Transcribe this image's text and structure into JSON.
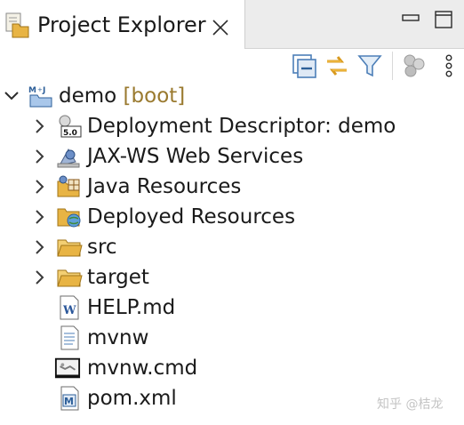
{
  "view": {
    "title": "Project Explorer",
    "icon": "project-explorer-icon",
    "close_icon": "close-icon",
    "minimize_icon": "minimize-icon",
    "maximize_icon": "maximize-icon"
  },
  "toolbar": {
    "buttons": [
      {
        "name": "collapse-all-button",
        "icon": "collapse-all-icon"
      },
      {
        "name": "link-with-editor-button",
        "icon": "link-with-editor-icon"
      },
      {
        "name": "filter-button",
        "icon": "filter-icon"
      },
      {
        "name": "focus-on-active-task-button",
        "icon": "focus-task-icon"
      },
      {
        "name": "view-menu-button",
        "icon": "view-menu-icon"
      }
    ]
  },
  "tree": {
    "root": {
      "label": "demo",
      "decoration": "[boot]",
      "icon": "spring-boot-project-icon",
      "expanded": true
    },
    "children": [
      {
        "label": "Deployment Descriptor: demo",
        "icon": "deployment-descriptor-icon",
        "expandable": true
      },
      {
        "label": "JAX-WS Web Services",
        "icon": "web-services-icon",
        "expandable": true
      },
      {
        "label": "Java Resources",
        "icon": "java-resources-icon",
        "expandable": true
      },
      {
        "label": "Deployed Resources",
        "icon": "deployed-resources-icon",
        "expandable": true
      },
      {
        "label": "src",
        "icon": "folder-icon",
        "expandable": true
      },
      {
        "label": "target",
        "icon": "folder-icon",
        "expandable": true
      },
      {
        "label": "HELP.md",
        "icon": "word-document-icon",
        "expandable": false
      },
      {
        "label": "mvnw",
        "icon": "text-file-icon",
        "expandable": false
      },
      {
        "label": "mvnw.cmd",
        "icon": "command-file-icon",
        "expandable": false
      },
      {
        "label": "pom.xml",
        "icon": "maven-pom-icon",
        "expandable": false
      }
    ]
  },
  "watermark": "知乎 @桔龙",
  "colors": {
    "decoration": "#9a7a2f",
    "folder": "#e8b444",
    "tab_background": "#ffffff",
    "titlebar_background": "#ececec"
  }
}
